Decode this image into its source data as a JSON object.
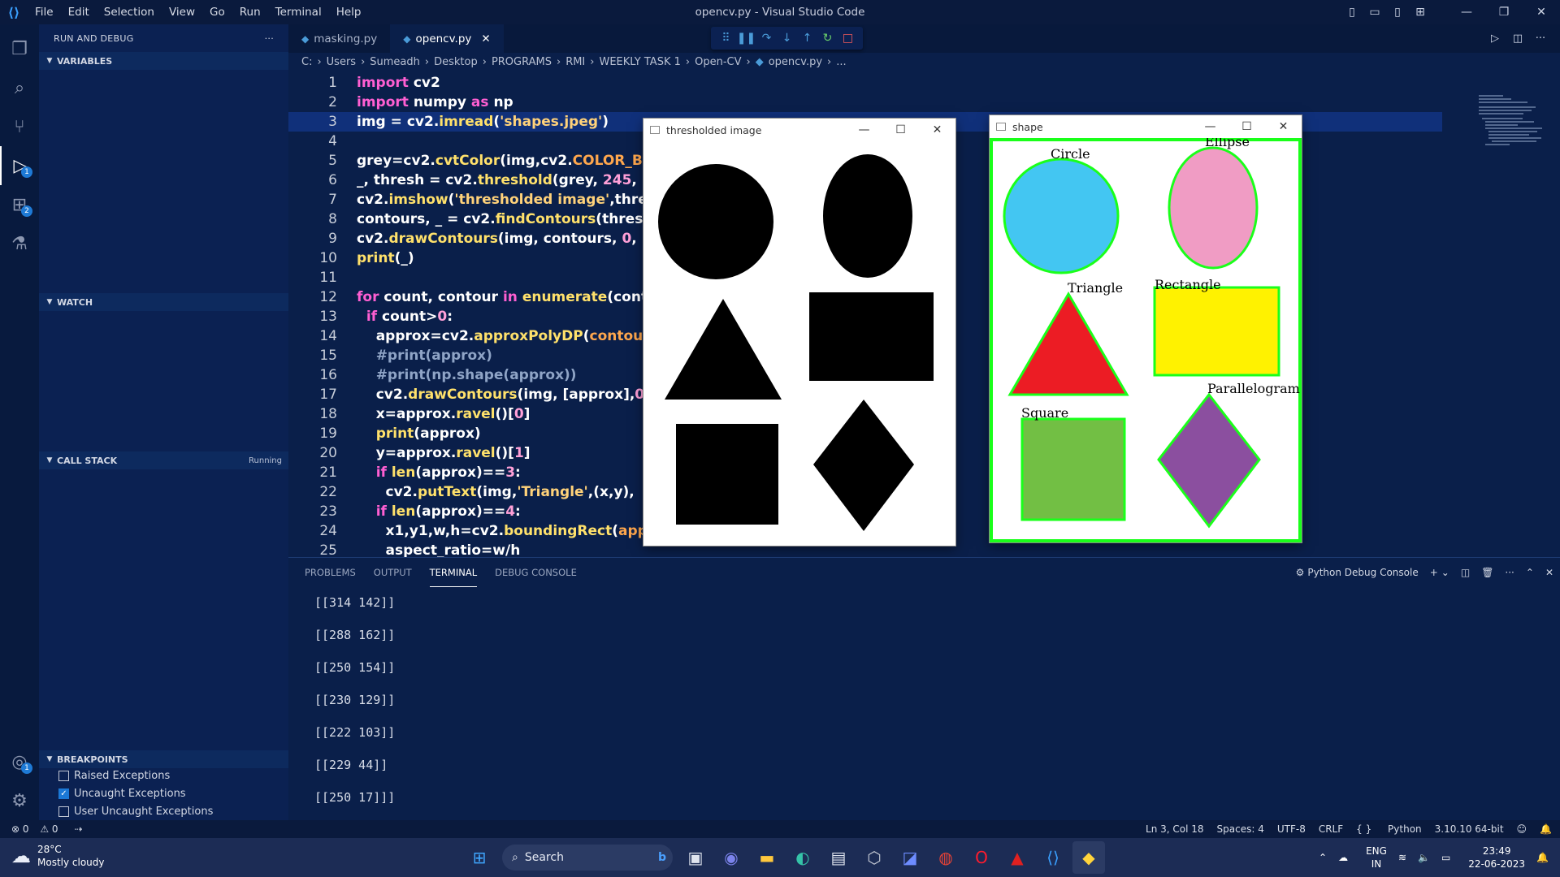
{
  "window": {
    "title": "opencv.py - Visual Studio Code",
    "menu": [
      "File",
      "Edit",
      "Selection",
      "View",
      "Go",
      "Run",
      "Terminal",
      "Help"
    ]
  },
  "sidebar": {
    "header": "RUN AND DEBUG",
    "sections": {
      "variables": "VARIABLES",
      "watch": "WATCH",
      "call_stack": "CALL STACK",
      "call_stack_state": "Running",
      "breakpoints": "BREAKPOINTS"
    },
    "breakpoints": [
      {
        "label": "Raised Exceptions",
        "checked": false
      },
      {
        "label": "Uncaught Exceptions",
        "checked": true
      },
      {
        "label": "User Uncaught Exceptions",
        "checked": false
      }
    ],
    "badges": {
      "debug": "1",
      "extensions": "2",
      "account": "1"
    }
  },
  "editor": {
    "tabs": [
      {
        "label": "masking.py",
        "active": false
      },
      {
        "label": "opencv.py",
        "active": true
      }
    ],
    "breadcrumb": [
      "C:",
      "Users",
      "Sumeadh",
      "Desktop",
      "PROGRAMS",
      "RMI",
      "WEEKLY TASK 1",
      "Open-CV",
      "opencv.py",
      "..."
    ],
    "line_numbers": [
      "1",
      "2",
      "3",
      "4",
      "5",
      "6",
      "7",
      "8",
      "9",
      "10",
      "11",
      "12",
      "13",
      "14",
      "15",
      "16",
      "17",
      "18",
      "19",
      "20",
      "21",
      "22",
      "23",
      "24",
      "25"
    ],
    "highlighted_line": 3
  },
  "cv_windows": {
    "thresholded": {
      "title": "thresholded image"
    },
    "shape": {
      "title": "shape",
      "labels": {
        "circle": "Circle",
        "ellipse": "Ellipse",
        "triangle": "Triangle",
        "rectangle": "Rectangle",
        "square": "Square",
        "parallelogram": "Parallelogram"
      },
      "colors": {
        "circle": "#43c6f2",
        "ellipse": "#f09cc4",
        "triangle": "#ec1c24",
        "rectangle": "#fff200",
        "square": "#72bf44",
        "parallelogram": "#8b4f9f",
        "contour": "#1aff1a"
      }
    }
  },
  "panel": {
    "tabs": [
      "PROBLEMS",
      "OUTPUT",
      "TERMINAL",
      "DEBUG CONSOLE"
    ],
    "active_tab": "TERMINAL",
    "console_label": "Python Debug Console",
    "terminal_lines": [
      "[[314 142]]",
      "[[288 162]]",
      "[[250 154]]",
      "[[230 129]]",
      "[[222 103]]",
      "[[229  44]]",
      "[[250  17]]]"
    ]
  },
  "statusbar": {
    "errors": "0",
    "warnings": "0",
    "position": "Ln 3, Col 18",
    "spaces": "Spaces: 4",
    "encoding": "UTF-8",
    "eol": "CRLF",
    "language": "Python",
    "interpreter": "3.10.10 64-bit"
  },
  "taskbar": {
    "temperature": "28°C",
    "weather": "Mostly cloudy",
    "search_placeholder": "Search",
    "lang": "ENG",
    "region": "IN",
    "time": "23:49",
    "date": "22-06-2023"
  }
}
